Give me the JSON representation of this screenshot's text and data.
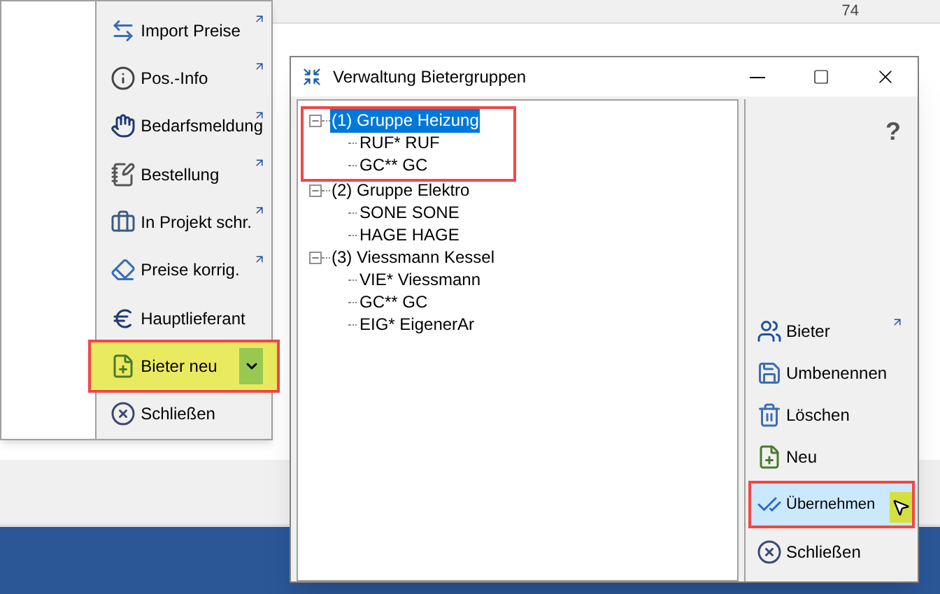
{
  "top_bar": {
    "page_count": "74"
  },
  "menu": {
    "items": [
      {
        "label": "Import Preise",
        "link": true,
        "kind": "button",
        "highlighted": false
      },
      {
        "label": "Pos.-Info",
        "link": true,
        "kind": "button",
        "highlighted": false
      },
      {
        "label": "Bedarfsmeldung",
        "link": true,
        "kind": "button",
        "highlighted": false
      },
      {
        "label": "Bestellung",
        "link": true,
        "kind": "button",
        "highlighted": false
      },
      {
        "label": "In Projekt schr.",
        "link": true,
        "kind": "button",
        "highlighted": false
      },
      {
        "label": "Preise korrig.",
        "link": true,
        "kind": "button",
        "highlighted": false
      },
      {
        "label": "Hauptlieferant",
        "link": false,
        "kind": "button",
        "highlighted": false
      },
      {
        "label": "Bieter neu",
        "link": false,
        "kind": "split",
        "highlighted": true
      },
      {
        "label": "Schließen",
        "link": false,
        "kind": "button",
        "highlighted": false
      }
    ]
  },
  "dialog": {
    "title": "Verwaltung Bietergruppen",
    "tree": [
      {
        "label": "(1) Gruppe Heizung",
        "expanded": true,
        "selected": true,
        "highlighted": true,
        "children": [
          {
            "label": "RUF* RUF"
          },
          {
            "label": "GC** GC"
          }
        ]
      },
      {
        "label": "(2) Gruppe Elektro",
        "expanded": true,
        "selected": false,
        "highlighted": false,
        "children": [
          {
            "label": "SONE SONE"
          },
          {
            "label": "HAGE HAGE"
          }
        ]
      },
      {
        "label": "(3) Viessmann Kessel",
        "expanded": true,
        "selected": false,
        "highlighted": false,
        "children": [
          {
            "label": "VIE* Viessmann"
          },
          {
            "label": "GC** GC"
          },
          {
            "label": "EIG* EigenerAr"
          }
        ]
      }
    ],
    "help": "?",
    "buttons": [
      {
        "label": "Bieter",
        "link": true,
        "hovered": false,
        "highlighted": false
      },
      {
        "label": "Umbenennen",
        "link": false,
        "hovered": false,
        "highlighted": false
      },
      {
        "label": "Löschen",
        "link": false,
        "hovered": false,
        "highlighted": false
      },
      {
        "label": "Neu",
        "link": false,
        "hovered": false,
        "highlighted": false
      },
      {
        "label": "Übernehmen",
        "link": false,
        "hovered": true,
        "highlighted": true
      },
      {
        "label": "Schließen",
        "link": false,
        "hovered": false,
        "highlighted": false
      }
    ]
  }
}
